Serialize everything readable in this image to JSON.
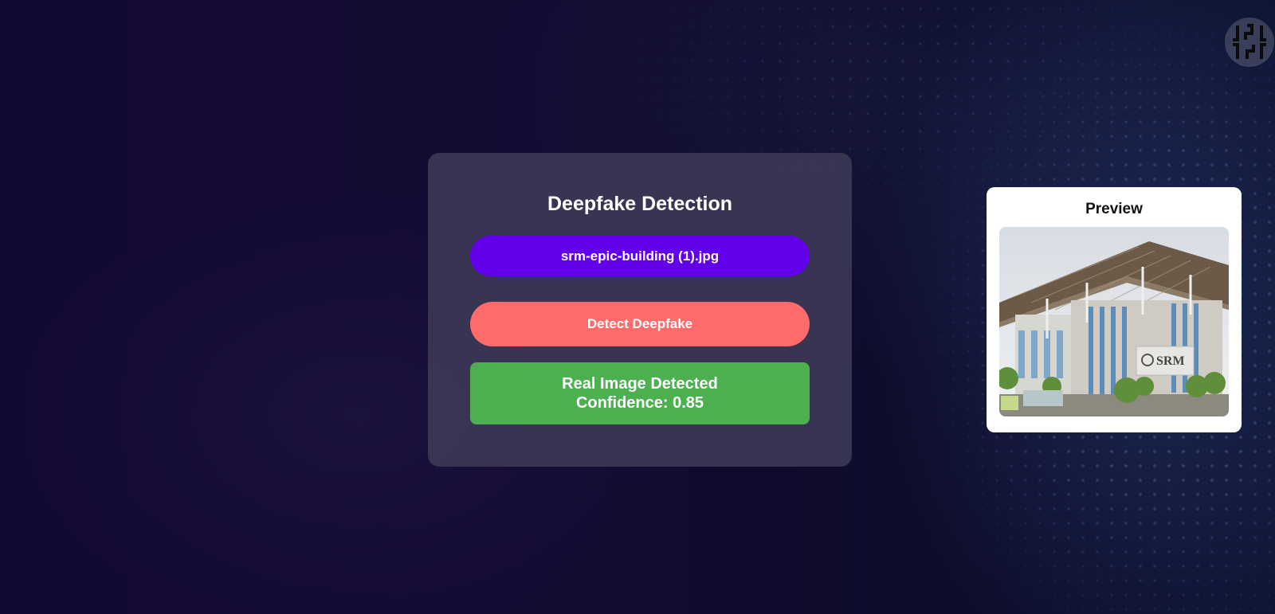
{
  "card": {
    "title": "Deepfake Detection",
    "file_button_label": "srm-epic-building (1).jpg",
    "detect_button_label": "Detect Deepfake",
    "result_line1": "Real Image Detected",
    "result_line2": "Confidence: 0.85"
  },
  "preview": {
    "title": "Preview",
    "image_signage": "SRM"
  },
  "colors": {
    "file_button": "#6200ea",
    "detect_button": "#ff6b6b",
    "result_box": "#4caf50",
    "card_bg": "#3e3a56"
  },
  "icons": {
    "corner_logo": "app-logo-icon"
  }
}
